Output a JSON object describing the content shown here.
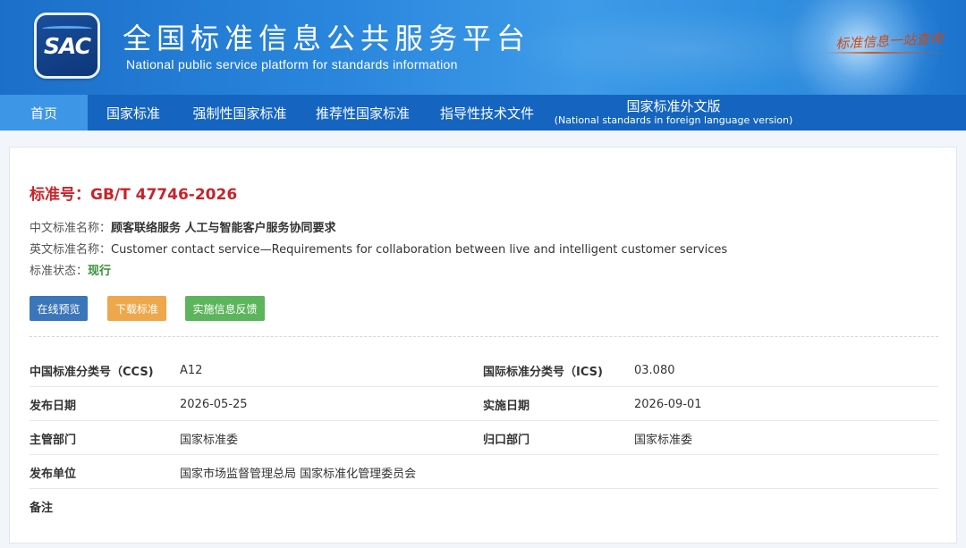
{
  "header": {
    "logo_text": "SAC",
    "title_cn": "全国标准信息公共服务平台",
    "title_en": "National public service platform  for standards information",
    "slogan": "标准信息一站查询"
  },
  "nav": {
    "items": [
      {
        "label": "首页",
        "active": true
      },
      {
        "label": "国家标准"
      },
      {
        "label": "强制性国家标准"
      },
      {
        "label": "推荐性国家标准"
      },
      {
        "label": "指导性技术文件"
      },
      {
        "label": "国家标准外文版",
        "sub": "(National standards in foreign language version)"
      }
    ]
  },
  "standard": {
    "number_label": "标准号：",
    "number": "GB/T 47746-2026",
    "cn_name_label": "中文标准名称：",
    "cn_name": "顾客联络服务 人工与智能客户服务协同要求",
    "en_name_label": "英文标准名称：",
    "en_name": "Customer contact service—Requirements for collaboration between live and intelligent customer services",
    "status_label": "标准状态：",
    "status": "现行"
  },
  "buttons": {
    "preview": "在线预览",
    "download": "下载标准",
    "feedback": "实施信息反馈"
  },
  "details": [
    {
      "k1": "中国标准分类号（CCS)",
      "v1": "A12",
      "k2": "国际标准分类号（ICS)",
      "v2": "03.080"
    },
    {
      "k1": "发布日期",
      "v1": "2026-05-25",
      "k2": "实施日期",
      "v2": "2026-09-01"
    },
    {
      "k1": "主管部门",
      "v1": "国家标准委",
      "k2": "归口部门",
      "v2": "国家标准委"
    },
    {
      "k1": "发布单位",
      "v1": "国家市场监督管理总局 国家标准化管理委员会",
      "k2": "",
      "v2": ""
    },
    {
      "k1": "备注",
      "v1": "",
      "k2": "",
      "v2": ""
    }
  ],
  "colors": {
    "header_blue": "#2a86dd",
    "nav_blue": "#1565c0",
    "nav_active": "#3d96e6",
    "std_red": "#c8232a",
    "status_green": "#3a8f3a",
    "btn_preview": "#3a76b9",
    "btn_download": "#eea74a",
    "btn_feedback": "#5cb55c"
  }
}
